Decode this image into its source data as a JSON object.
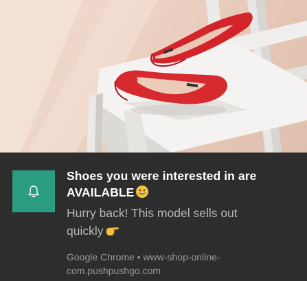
{
  "notification": {
    "image": {
      "icon": "red-shoes-on-chair-image"
    },
    "app_icon": {
      "icon": "bell-icon",
      "background_color": "#2a9d80"
    },
    "title_line1": "Shoes you were interested in are",
    "title_line2": "AVAILABLE",
    "title_emoji": "grinning-face-icon",
    "message_line1": "Hurry back! This model sells out",
    "message_line2": "quickly",
    "message_emoji": "pointing-hand-icon",
    "source_line1": "Google Chrome • www-shop-online-",
    "source_line2": "com.pushpushgo.com"
  }
}
